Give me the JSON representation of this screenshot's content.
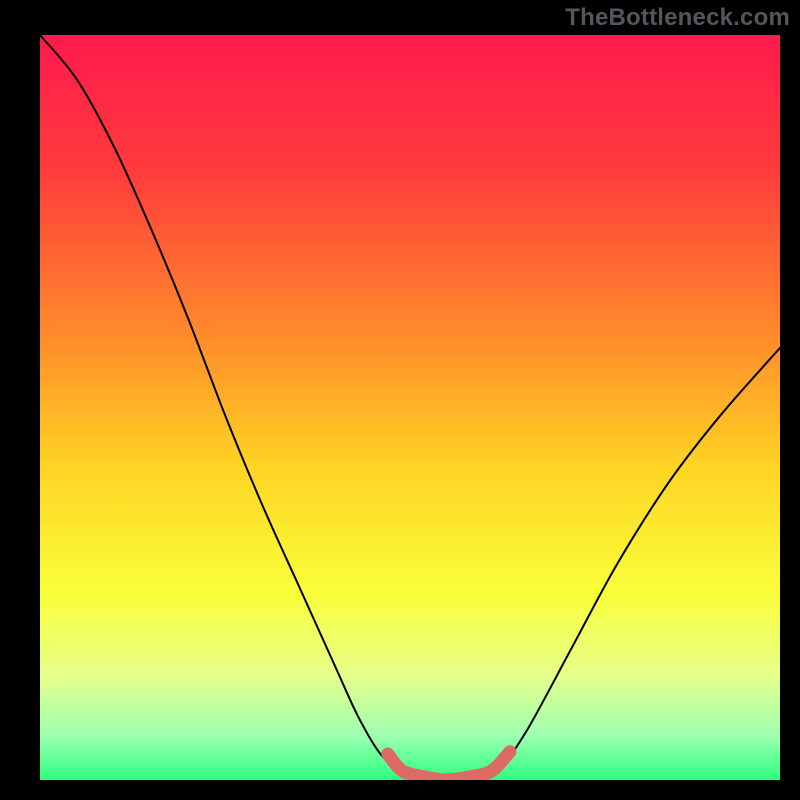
{
  "watermark": "TheBottleneck.com",
  "chart_data": {
    "type": "line",
    "title": "",
    "xlabel": "",
    "ylabel": "",
    "xlim": [
      0,
      1
    ],
    "ylim": [
      0,
      1
    ],
    "gradient_stops": [
      {
        "offset": 0.0,
        "color": "#ff1a4d"
      },
      {
        "offset": 0.18,
        "color": "#ff3b3b"
      },
      {
        "offset": 0.4,
        "color": "#ff8a2b"
      },
      {
        "offset": 0.58,
        "color": "#ffd423"
      },
      {
        "offset": 0.75,
        "color": "#f9ff3a"
      },
      {
        "offset": 0.86,
        "color": "#e5ff8a"
      },
      {
        "offset": 0.94,
        "color": "#9fffb2"
      },
      {
        "offset": 1.0,
        "color": "#2bff7e"
      }
    ],
    "series": [
      {
        "name": "left-curve",
        "stroke": "#000000",
        "x": [
          0.0,
          0.05,
          0.1,
          0.15,
          0.2,
          0.25,
          0.3,
          0.35,
          0.4,
          0.43,
          0.46,
          0.49
        ],
        "values": [
          1.0,
          0.94,
          0.85,
          0.74,
          0.62,
          0.49,
          0.37,
          0.26,
          0.15,
          0.085,
          0.035,
          0.01
        ]
      },
      {
        "name": "right-curve",
        "stroke": "#000000",
        "x": [
          0.62,
          0.66,
          0.72,
          0.78,
          0.85,
          0.92,
          1.0
        ],
        "values": [
          0.01,
          0.07,
          0.18,
          0.29,
          0.4,
          0.49,
          0.58
        ]
      },
      {
        "name": "floor-connector",
        "stroke": "#dd6a64",
        "thick": true,
        "x": [
          0.47,
          0.49,
          0.52,
          0.55,
          0.58,
          0.61,
          0.635
        ],
        "values": [
          0.035,
          0.012,
          0.004,
          0.0,
          0.004,
          0.012,
          0.038
        ]
      }
    ]
  }
}
